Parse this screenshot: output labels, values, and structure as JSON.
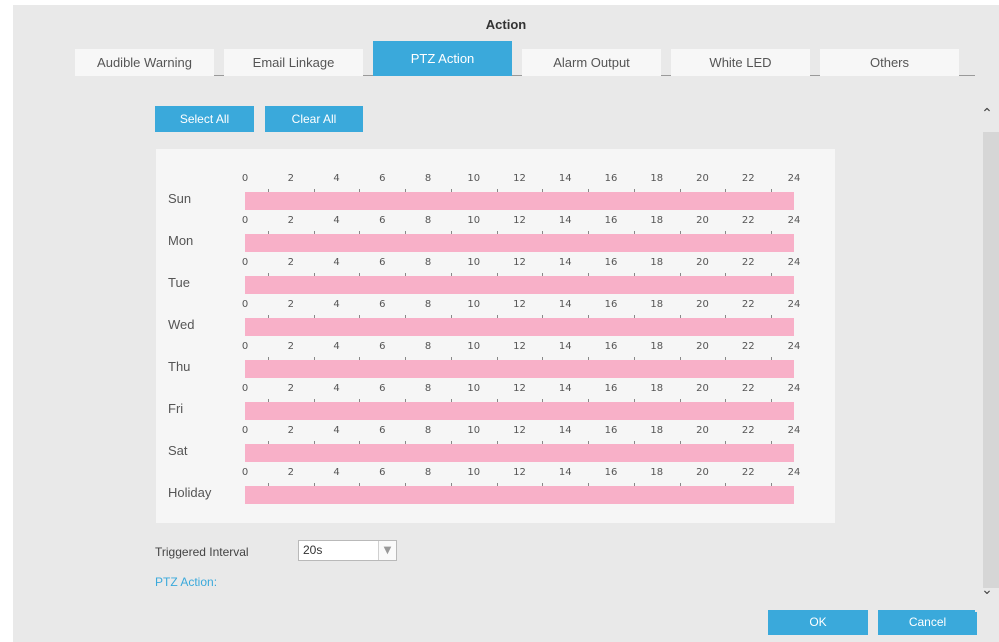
{
  "dialog": {
    "title": "Action"
  },
  "tabs": [
    {
      "label": "Audible Warning",
      "active": false
    },
    {
      "label": "Email Linkage",
      "active": false
    },
    {
      "label": "PTZ Action",
      "active": true
    },
    {
      "label": "Alarm Output",
      "active": false
    },
    {
      "label": "White LED",
      "active": false
    },
    {
      "label": "Others",
      "active": false
    }
  ],
  "buttons": {
    "select_all": "Select All",
    "clear_all": "Clear All",
    "ok": "OK",
    "cancel": "Cancel"
  },
  "schedule": {
    "hour_ticks": [
      "0",
      "2",
      "4",
      "6",
      "8",
      "10",
      "12",
      "14",
      "16",
      "18",
      "20",
      "22",
      "24"
    ],
    "days": [
      {
        "label": "Sun",
        "coverage": 1.0
      },
      {
        "label": "Mon",
        "coverage": 1.0
      },
      {
        "label": "Tue",
        "coverage": 1.0
      },
      {
        "label": "Wed",
        "coverage": 1.0
      },
      {
        "label": "Thu",
        "coverage": 1.0
      },
      {
        "label": "Fri",
        "coverage": 1.0
      },
      {
        "label": "Sat",
        "coverage": 1.0
      },
      {
        "label": "Holiday",
        "coverage": 1.0
      }
    ],
    "bar_color": "#f8b0c8"
  },
  "triggered_interval": {
    "label": "Triggered Interval",
    "value": "20s"
  },
  "ptz_action": {
    "label": "PTZ Action:"
  },
  "scrollbar": {
    "up_icon": "chevron-up-icon",
    "down_icon": "chevron-down-icon"
  },
  "colors": {
    "accent": "#3aa9db",
    "background": "#e9e9e9"
  }
}
